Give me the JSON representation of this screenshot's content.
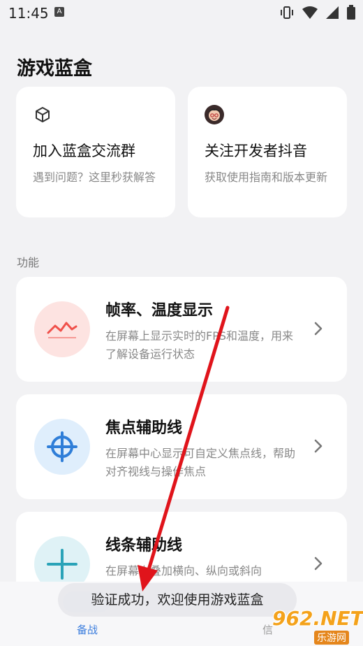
{
  "status_bar": {
    "time": "11:45",
    "notification_glyph": "A",
    "icons": [
      "vibrate-icon",
      "wifi-icon",
      "signal-icon",
      "battery-icon"
    ]
  },
  "app": {
    "title": "游戏蓝盒"
  },
  "top_cards": [
    {
      "title": "加入蓝盒交流群",
      "subtitle": "遇到问题？这里秒获解答",
      "icon": "cube-icon"
    },
    {
      "title": "关注开发者抖音",
      "subtitle": "获取使用指南和版本更新",
      "icon": "developer-avatar"
    }
  ],
  "section": {
    "label": "功能"
  },
  "features": [
    {
      "title": "帧率、温度显示",
      "description": "在屏幕上显示实时的FPS和温度，用来了解设备运行状态",
      "icon": "fps-chart-icon",
      "accent": "#f0504a",
      "bg": "#fde3e1"
    },
    {
      "title": "焦点辅助线",
      "description": "在屏幕中心显示可自定义焦点线，帮助对齐视线与操作焦点",
      "icon": "crosshair-icon",
      "accent": "#2f7ed8",
      "bg": "#dfeefc"
    },
    {
      "title": "线条辅助线",
      "description": "在屏幕上叠加横向、纵向或斜向",
      "icon": "plus-lines-icon",
      "accent": "#2aa3b8",
      "bg": "#dff2f6"
    }
  ],
  "bottom_nav": {
    "tabs": [
      {
        "label": "备战",
        "active": true
      },
      {
        "label": "信"
      }
    ],
    "active_color": "#3b7ddd"
  },
  "toast": {
    "message": "验证成功，欢迎使用游戏蓝盒"
  },
  "watermark": {
    "main": "962.NET",
    "sub": "乐游网"
  }
}
